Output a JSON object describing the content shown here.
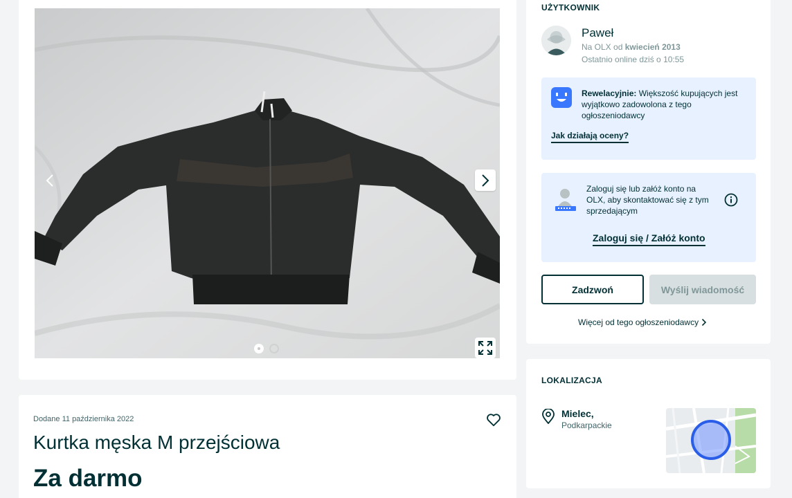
{
  "gallery": {
    "prev_label": "‹",
    "next_label": "›",
    "dots_total": 2,
    "active_dot": 1
  },
  "listing": {
    "added_text": "Dodane 11 października 2022",
    "title": "Kurtka męska M przejściowa",
    "price": "Za darmo"
  },
  "user": {
    "heading": "UŻYTKOWNIK",
    "name": "Paweł",
    "since_prefix": "Na OLX od",
    "since_value": "kwiecień 2013",
    "last_online": "Ostatnio online dziś o 10:55",
    "rating": {
      "label": "Rewelacyjnie:",
      "text": "Większość kupujących jest wyjątkowo zadowolona z tego ogłoszeniodawcy",
      "link": "Jak działają oceny?"
    },
    "login_prompt": {
      "text": "Zaloguj się lub załóż konto na OLX, aby skontaktować się z tym sprzedającym",
      "link": "Zaloguj się / Załóż konto"
    },
    "call_button": "Zadzwoń",
    "message_button": "Wyślij wiadomość",
    "more_link": "Więcej od tego ogłoszeniodawcy"
  },
  "location": {
    "heading": "LOKALIZACJA",
    "city": "Mielec,",
    "region": "Podkarpackie"
  },
  "colors": {
    "brand_dark": "#002f34",
    "info_bg": "#e8f1ff",
    "accent_blue": "#3a77ff",
    "page_bg": "#f2f4f5"
  }
}
